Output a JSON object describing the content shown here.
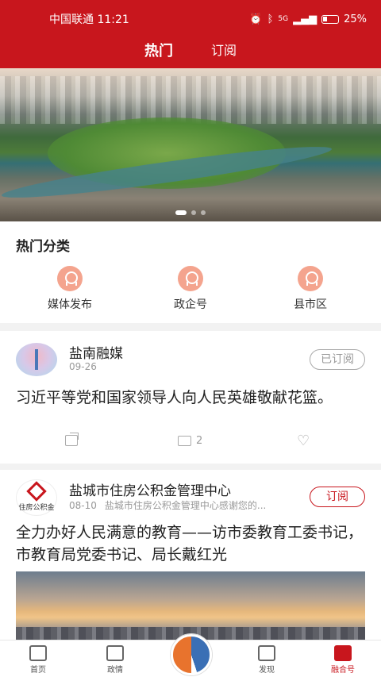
{
  "status": {
    "carrier_time": "中国联通 11:21",
    "battery": "25%",
    "signal": "5G"
  },
  "tabs": [
    {
      "label": "热门"
    },
    {
      "label": "订阅"
    }
  ],
  "hot_categories": {
    "title": "热门分类",
    "items": [
      {
        "label": "媒体发布"
      },
      {
        "label": "政企号"
      },
      {
        "label": "县市区"
      }
    ]
  },
  "posts": [
    {
      "author": "盐南融媒",
      "date": "09-26",
      "subscribe_label": "已订阅",
      "title": "习近平等党和国家领导人向人民英雄敬献花篮。",
      "comment_count": "2"
    },
    {
      "author": "盐城市住房公积金管理中心",
      "avatar_text": "住房公积金",
      "date": "08-10",
      "desc": "盐城市住房公积金管理中心感谢您的...",
      "subscribe_label": "订阅",
      "title": "全力办好人民满意的教育——访市委教育工委书记，市教育局党委书记、局长戴红光"
    }
  ],
  "bottom_nav": [
    {
      "label": "首页"
    },
    {
      "label": "政情"
    },
    {
      "label": "发现"
    },
    {
      "label": "融合号"
    }
  ],
  "colors": {
    "brand": "#c8161d"
  }
}
